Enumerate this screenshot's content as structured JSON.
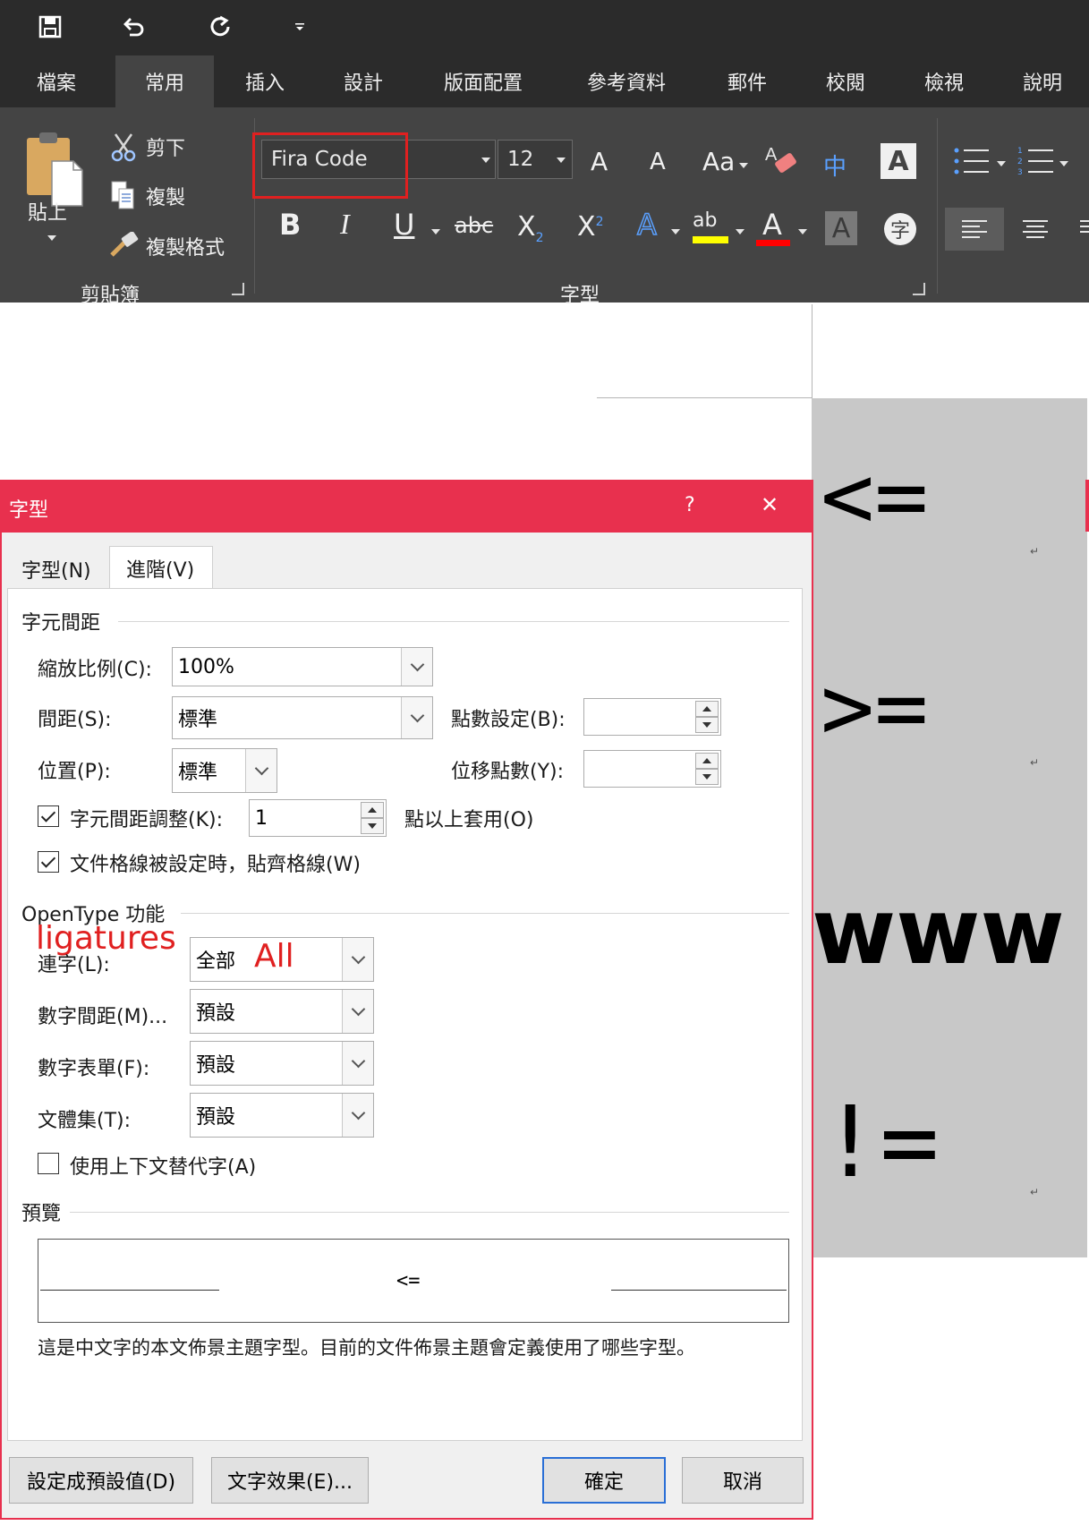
{
  "quick_access": {
    "save_icon": "save-icon",
    "undo_icon": "undo-icon",
    "redo_icon": "redo-icon",
    "customize_icon": "customize-icon"
  },
  "tabs": [
    {
      "label": "檔案",
      "active": false
    },
    {
      "label": "常用",
      "active": true
    },
    {
      "label": "插入",
      "active": false
    },
    {
      "label": "設計",
      "active": false
    },
    {
      "label": "版面配置",
      "active": false
    },
    {
      "label": "參考資料",
      "active": false
    },
    {
      "label": "郵件",
      "active": false
    },
    {
      "label": "校閱",
      "active": false
    },
    {
      "label": "檢視",
      "active": false
    },
    {
      "label": "說明",
      "active": false
    }
  ],
  "clipboard": {
    "paste_label": "貼上",
    "cut_label": "剪下",
    "copy_label": "複製",
    "format_painter_label": "複製格式",
    "group_label": "剪貼簿"
  },
  "font_group": {
    "font_name": "Fira Code",
    "font_size": "12",
    "group_label": "字型",
    "grow_label": "A",
    "shrink_label": "A",
    "case_label": "Aa",
    "phonetic_label": "中",
    "border_label": "A",
    "bold_label": "B",
    "italic_label": "I",
    "underline_label": "U",
    "strike_label": "abc",
    "subscript_label": "X",
    "subscript_sub": "2",
    "superscript_label": "X",
    "superscript_sup": "2",
    "effect_label": "A",
    "highlight_label": "ab",
    "font_color_label": "A",
    "shading_label": "A",
    "enclose_label": "字",
    "accent": "#e8304e",
    "highlight_color": "#ffff00",
    "font_color": "#ff0000"
  },
  "document": {
    "line1": "<=",
    "line2": ">=",
    "line3": "www",
    "line4": "!=",
    "para_mark": "↵"
  },
  "dialog": {
    "title": "字型",
    "help": "?",
    "close": "✕",
    "tab_font": "字型(N)",
    "tab_advanced": "進階(V)",
    "section_spacing": "字元間距",
    "scale_label": "縮放比例(C):",
    "scale_value": "100%",
    "spacing_label": "間距(S):",
    "spacing_value": "標準",
    "by_label": "點數設定(B):",
    "position_label": "位置(P):",
    "position_value": "標準",
    "by2_label": "位移點數(Y):",
    "kerning_label": "字元間距調整(K):",
    "kerning_value": "1",
    "kerning_suffix": "點以上套用(O)",
    "grid_label": "文件格線被設定時，貼齊格線(W)",
    "section_opentype": "OpenType 功能",
    "annot_ligatures": "ligatures",
    "ligatures_label": "連字(L):",
    "ligatures_value": "全部",
    "annot_all": "All",
    "num_spacing_label": "數字間距(M)...",
    "num_spacing_value": "預設",
    "num_forms_label": "數字表單(F):",
    "num_forms_value": "預設",
    "stylistic_label": "文體集(T):",
    "stylistic_value": "預設",
    "contextual_label": "使用上下文替代字(A)",
    "section_preview": "預覽",
    "preview_text": "<=",
    "preview_desc": "這是中文字的本文佈景主題字型。目前的文件佈景主題會定義使用了哪些字型。",
    "btn_default": "設定成預設值(D)",
    "btn_effects": "文字效果(E)...",
    "btn_ok": "確定",
    "btn_cancel": "取消"
  }
}
